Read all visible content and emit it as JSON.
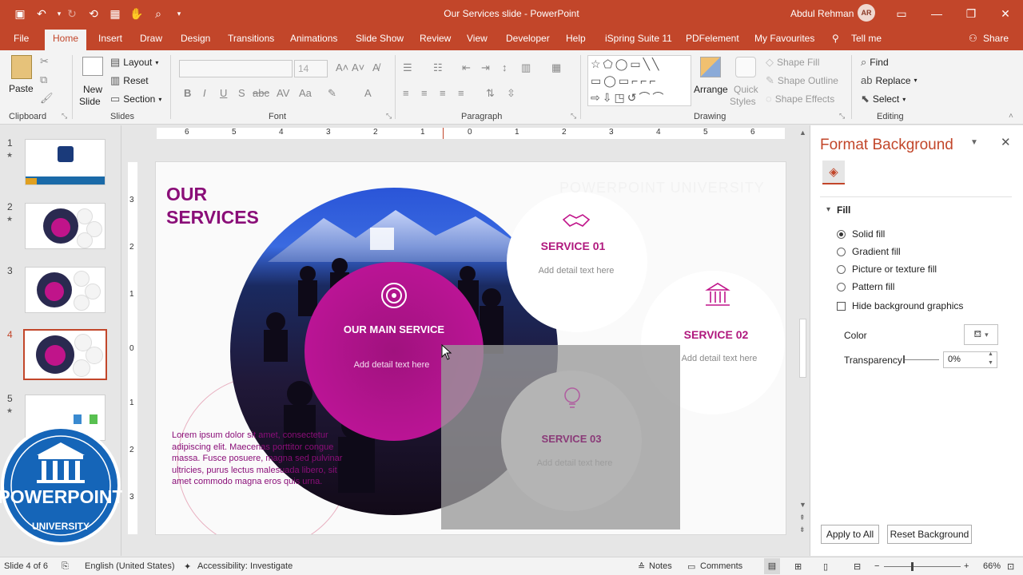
{
  "window": {
    "title": "Our Services slide  -  PowerPoint",
    "user_name": "Abdul Rehman",
    "user_initials": "AR"
  },
  "tabs": [
    "File",
    "Home",
    "Insert",
    "Draw",
    "Design",
    "Transitions",
    "Animations",
    "Slide Show",
    "Review",
    "View",
    "Developer",
    "Help",
    "iSpring Suite 11",
    "PDFelement",
    "My Favourites",
    "Tell me",
    "Share"
  ],
  "ribbon": {
    "clipboard": {
      "paste": "Paste",
      "label": "Clipboard"
    },
    "slides": {
      "new_slide_1": "New",
      "new_slide_2": "Slide",
      "layout": "Layout",
      "reset": "Reset",
      "section": "Section",
      "label": "Slides"
    },
    "font": {
      "size": "14",
      "label": "Font"
    },
    "paragraph": {
      "label": "Paragraph"
    },
    "drawing": {
      "arrange": "Arrange",
      "quick_styles_1": "Quick",
      "quick_styles_2": "Styles",
      "shape_fill": "Shape Fill",
      "shape_outline": "Shape Outline",
      "shape_effects": "Shape Effects",
      "label": "Drawing"
    },
    "editing": {
      "find": "Find",
      "replace": "Replace",
      "select": "Select",
      "label": "Editing"
    }
  },
  "thumbnails": [
    {
      "num": "1",
      "star": "★"
    },
    {
      "num": "2",
      "star": "★"
    },
    {
      "num": "3",
      "star": ""
    },
    {
      "num": "4",
      "star": ""
    },
    {
      "num": "5",
      "star": "★"
    }
  ],
  "ruler": {
    "h": [
      "6",
      "5",
      "4",
      "3",
      "2",
      "1",
      "0",
      "1",
      "2",
      "3",
      "4",
      "5",
      "6"
    ],
    "v": [
      "3",
      "2",
      "1",
      "0",
      "1",
      "2",
      "3"
    ]
  },
  "slide": {
    "title_line1": "OUR",
    "title_line2": "SERVICES",
    "watermark": "POWERPOINT UNIVERSITY",
    "main_title": "OUR MAIN SERVICE",
    "main_text": "Add detail text here",
    "services": [
      {
        "title": "SERVICE 01",
        "text": "Add detail text here",
        "icon": "handshake-icon"
      },
      {
        "title": "SERVICE 02",
        "text": "Add detail text here",
        "icon": "bank-icon"
      },
      {
        "title": "SERVICE 03",
        "text": "Add detail text here",
        "icon": "lightbulb-icon"
      }
    ],
    "lorem": "Lorem ipsum dolor sit amet, consectetur adipiscing elit. Maecenas porttitor congue massa. Fusce posuere, magna sed pulvinar ultricies, purus lectus malesuada libero, sit amet commodo magna eros quis urna."
  },
  "logo": {
    "line1": "POWERPOINT",
    "line2": "UNIVERSITY"
  },
  "format_pane": {
    "title": "Format Background",
    "fill_section": "Fill",
    "options": [
      "Solid fill",
      "Gradient fill",
      "Picture or texture fill",
      "Pattern fill"
    ],
    "selected_option": "Solid fill",
    "hide_bg": "Hide background graphics",
    "color_label": "Color",
    "transparency_label": "Transparency",
    "transparency_value": "0%",
    "apply_all": "Apply to All",
    "reset_bg": "Reset Background"
  },
  "status": {
    "slide_of": "Slide 4 of 6",
    "language": "English (United States)",
    "accessibility": "Accessibility: Investigate",
    "notes": "Notes",
    "comments": "Comments",
    "zoom": "66%"
  },
  "colors": {
    "accent": "#c2462a",
    "brand_magenta": "#b0197e"
  }
}
